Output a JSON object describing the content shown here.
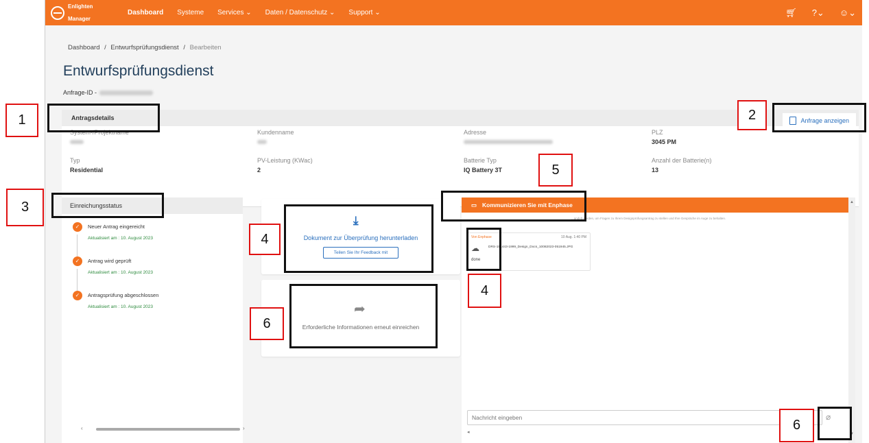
{
  "app": {
    "logo_line1": "Enlighten",
    "logo_line2": "Manager"
  },
  "nav": {
    "items": [
      {
        "label": "Dashboard",
        "active": true
      },
      {
        "label": "Systeme"
      },
      {
        "label": "Services ⌄"
      },
      {
        "label": "Daten / Datenschutz ⌄"
      },
      {
        "label": "Support ⌄"
      }
    ],
    "right_icons": [
      "cart-icon",
      "help-icon",
      "user-icon"
    ]
  },
  "breadcrumb": {
    "item1": "Dashboard",
    "item2": "Entwurfsprüfungsdienst",
    "current": "Bearbeiten",
    "separator": "/"
  },
  "page": {
    "title": "Entwurfsprüfungsdienst",
    "request_id_label": "Anfrage-ID -"
  },
  "details": {
    "header": "Antragsdetails",
    "view_button": "Anfrage anzeigen",
    "fields": {
      "system_name": {
        "label": "System-/Projektname",
        "value": ""
      },
      "customer": {
        "label": "Kundenname",
        "value": ""
      },
      "address": {
        "label": "Adresse",
        "value": ""
      },
      "zip": {
        "label": "PLZ",
        "value": "3045 PM"
      },
      "type": {
        "label": "Typ",
        "value": "Residential"
      },
      "pv_power": {
        "label": "PV-Leistung (KWac)",
        "value": "2"
      },
      "battery_type": {
        "label": "Batterie Typ",
        "value": "IQ Battery 3T"
      },
      "battery_count": {
        "label": "Anzahl der Batterie(n)",
        "value": "13"
      }
    }
  },
  "status": {
    "header": "Einreichungsstatus",
    "steps": [
      {
        "title": "Neuer Antrag eingereicht",
        "date": "Aktualisiert am : 10. August 2023"
      },
      {
        "title": "Antrag wird geprüft",
        "date": "Aktualisiert am : 10. August 2023"
      },
      {
        "title": "Antragsprüfung abgeschlossen",
        "date": "Aktualisiert am : 10. August 2023"
      }
    ],
    "check_glyph": "✓"
  },
  "download_card": {
    "text": "Dokument zur Überprüfung herunterladen",
    "feedback_button": "Teilen Sie Ihr Feedback mit"
  },
  "resubmit_card": {
    "text": "Erforderliche Informationen erneut einreichen"
  },
  "chat": {
    "header": "Kommunizieren Sie mit Enphase",
    "info": "...andelt werden, um Fragen zu Ihrem Designprüfungsantrag zu stellen und Ihre Gespräche im Auge zu behalten.",
    "message": {
      "from": "Von Enphase",
      "time": "10 Aug. 1:40 PM",
      "file": "DRS-151443-1999_Design_Docs_10082023-051945.JPG",
      "status": "done"
    },
    "input_placeholder": "Nachricht eingeben"
  },
  "annotations": [
    "1",
    "2",
    "3",
    "4",
    "4",
    "5",
    "6",
    "6"
  ],
  "colors": {
    "brand": "#f37321",
    "link": "#2a6fbd",
    "title": "#23405c",
    "success": "#2e8b3e",
    "annotation_red": "#e01010"
  }
}
